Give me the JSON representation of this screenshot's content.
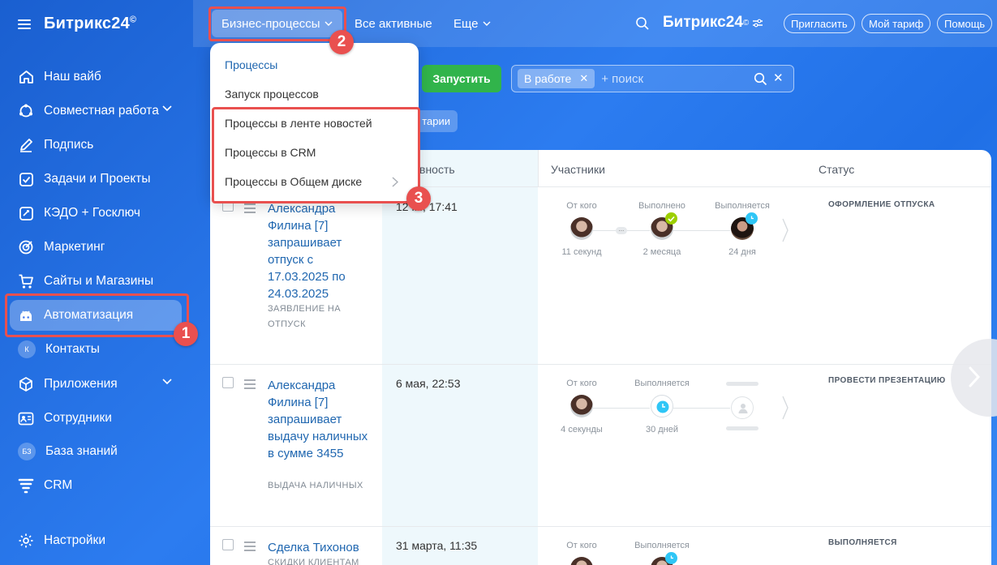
{
  "brand": {
    "name": "Битрикс24",
    "mark": "©"
  },
  "sidebar": {
    "items": [
      {
        "label": "Наш вайб"
      },
      {
        "label": "Совместная работа"
      },
      {
        "label": "Подпись"
      },
      {
        "label": "Задачи и Проекты"
      },
      {
        "label": "КЭДО + Госключ"
      },
      {
        "label": "Маркетинг"
      },
      {
        "label": "Сайты и Магазины"
      },
      {
        "label": "Автоматизация"
      },
      {
        "label": "Контакты",
        "badge": "К"
      },
      {
        "label": "Приложения"
      },
      {
        "label": "Сотрудники"
      },
      {
        "label": "База знаний",
        "badge": "БЗ"
      },
      {
        "label": "CRM"
      }
    ],
    "settings": "Настройки"
  },
  "topbar": {
    "tab_business": "Бизнес-процессы",
    "tab_active": "Все активные",
    "tab_more": "Еще",
    "logo": "Битрикс24",
    "invite": "Пригласить",
    "plan": "Мой тариф",
    "help": "Помощь"
  },
  "callouts": {
    "one": "1",
    "two": "2",
    "three": "3"
  },
  "dropdown": {
    "items": [
      "Процессы",
      "Запуск процессов",
      "Процессы в ленте новостей",
      "Процессы в CRM",
      "Процессы в Общем диске"
    ]
  },
  "toolbar": {
    "run_button": "Запустить",
    "filter_chip": "В работе",
    "search_placeholder": "+ поиск",
    "secondary_chip": "тарии"
  },
  "table": {
    "headers": {
      "activity": "вность",
      "participants": "Участники",
      "status": "Статус"
    },
    "rows": [
      {
        "title": "Александра Филина [7] запрашивает отпуск с 17.03.2025 по 24.03.2025",
        "subtype": "ЗАЯВЛЕНИЕ НА ОТПУСК",
        "date": "12 м., 17:41",
        "status": "ОФОРМЛЕНИЕ ОТПУСКА",
        "participants": [
          {
            "label": "От кого",
            "time": "11 секунд"
          },
          {
            "label": "Выполнено",
            "time": "2 месяца"
          },
          {
            "label": "Выполняется",
            "time": "24 дня"
          }
        ]
      },
      {
        "title": "Александра Филина [7] запрашивает выдачу наличных в сумме 3455",
        "subtype": "ВЫДАЧА НАЛИЧНЫХ",
        "date": "6 мая, 22:53",
        "status": "ПРОВЕСТИ ПРЕЗЕНТАЦИЮ",
        "participants": [
          {
            "label": "От кого",
            "time": "4 секунды"
          },
          {
            "label": "Выполняется",
            "time": "30 дней"
          }
        ]
      },
      {
        "title": "Сделка Тихонов",
        "subtype": "СКИДКИ КЛИЕНТАМ",
        "date": "31 марта, 11:35",
        "status": "ВЫПОЛНЯЕТСЯ",
        "participants": [
          {
            "label": "От кого"
          },
          {
            "label": "Выполняется"
          }
        ]
      }
    ]
  },
  "colors": {
    "accent_red": "#e9504f",
    "run_green": "#31b44b",
    "link_blue": "#2067b0"
  }
}
